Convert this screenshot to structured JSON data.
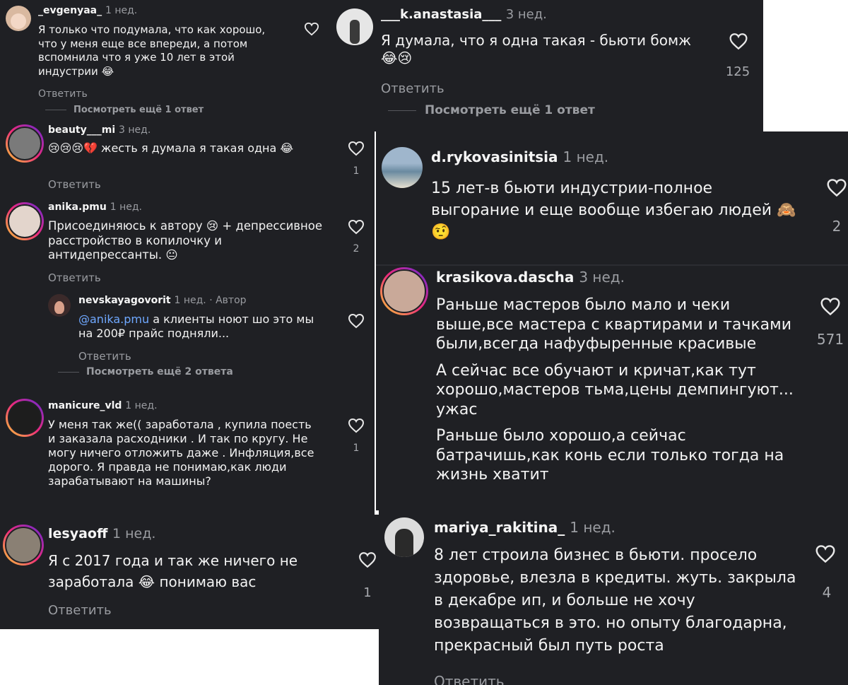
{
  "comments": {
    "c1": {
      "username": "_evgenyaa_",
      "time": "1 нед.",
      "text": "Я только что подумала, что как хорошо, что у меня еще все впереди, а потом вспомнила что я уже 10 лет в этой индустрии 😂",
      "reply": "Ответить",
      "more": "Посмотреть ещё 1 ответ"
    },
    "c2": {
      "username": "___k.anastasia___",
      "time": "3 нед.",
      "text": "Я думала, что я одна такая - бьюти бомж 😂😢",
      "likes": "125",
      "reply": "Ответить",
      "more": "Посмотреть ещё 1 ответ"
    },
    "c3": {
      "username": "beauty___mi",
      "time": "3 нед.",
      "text": "😢😢😢💔 жесть я думала я такая одна 😂",
      "likes": "1",
      "reply": "Ответить"
    },
    "c4": {
      "username": "d.rykovasinitsia",
      "time": "1 нед.",
      "text": "15 лет-в бьюти индустрии-полное выгорание и еще вообще избегаю людей 🙈🤨",
      "likes": "2"
    },
    "c5": {
      "username": "anika.pmu",
      "time": "1 нед.",
      "text": "Присоединяюсь к автору 😢 + депрессивное расстройство в копилочку и антидепрессанты. 😐",
      "likes": "2",
      "reply": "Ответить"
    },
    "c6": {
      "username": "nevskayagovorit",
      "time": "1 нед. · Автор",
      "mention": "@anika.pmu",
      "text": " а клиенты ноют шо это мы на 200₽ прайс подняли...",
      "reply": "Ответить",
      "more": "Посмотреть ещё 2 ответа"
    },
    "c7": {
      "username": "krasikova.dascha",
      "time": "3 нед.",
      "p1": "Раньше мастеров было мало и чеки выше,все мастера с квартирами и тачками были,всегда нафуфыренные красивые",
      "p2": "А сейчас все обучают и кричат,как тут хорошо,мастеров тьма,цены демпингуют... ужас",
      "p3": "Раньше было хорошо,а сейчас батрачишь,как конь если только тогда на жизнь хватит",
      "likes": "571"
    },
    "c8": {
      "username": "manicure_vld",
      "time": "1 нед.",
      "text": "У меня так же(( заработала , купила поесть и заказала расходники . И так по кругу. Не могу ничего отложить даже . Инфляция,все дорого. Я правда не понимаю,как люди зарабатывают на машины?",
      "likes": "1"
    },
    "c9": {
      "username": "lesyaoff",
      "time": "1 нед.",
      "text": "Я с 2017 года и так же ничего не заработала 😂 понимаю вас",
      "likes": "1",
      "reply": "Ответить"
    },
    "c10": {
      "username": "mariya_rakitina_",
      "time": "1 нед.",
      "text": "8 лет строила бизнес в бьюти. просело здоровье, влезла в кредиты. жуть. закрыла в декабре ип, и больше не хочу возвращаться в это. но опыту благодарна, прекрасный был путь роста",
      "likes": "4",
      "reply": "Ответить"
    }
  },
  "colors": {
    "panel_bg": "#1f2024",
    "text": "#f2f2f2",
    "muted": "#9a9ca1",
    "mention": "#6fa8ff",
    "heart": "#e8e8e8"
  },
  "icons": {
    "like": "heart-outline-icon"
  }
}
